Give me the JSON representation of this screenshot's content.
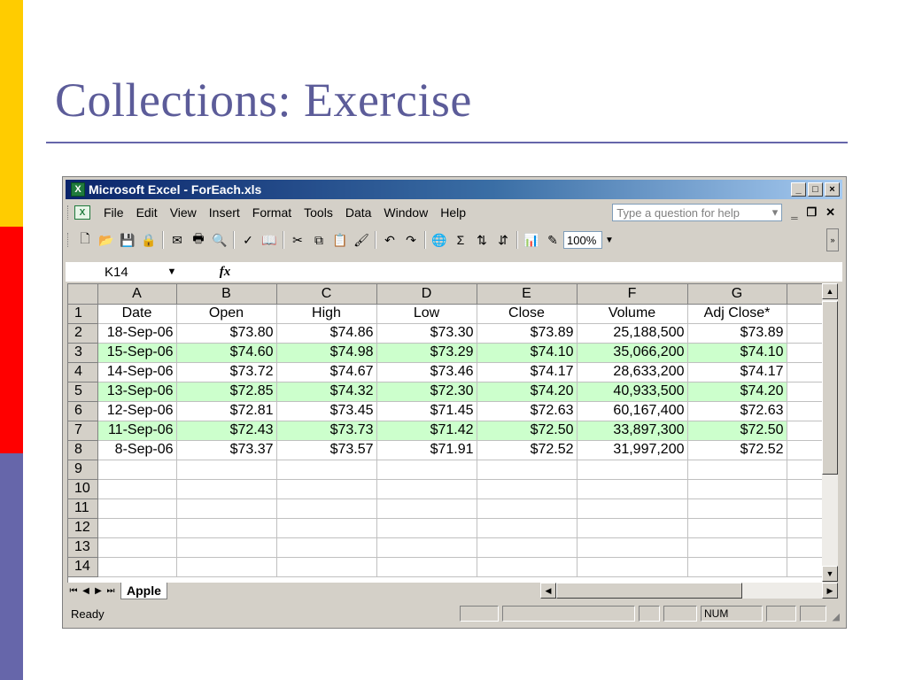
{
  "slide": {
    "title": "Collections: Exercise"
  },
  "window": {
    "title": "Microsoft Excel - ForEach.xls",
    "controls": {
      "minimize": "_",
      "restore": "□",
      "close": "×"
    }
  },
  "menubar": {
    "items": [
      {
        "label": "File"
      },
      {
        "label": "Edit"
      },
      {
        "label": "View"
      },
      {
        "label": "Insert"
      },
      {
        "label": "Format"
      },
      {
        "label": "Tools"
      },
      {
        "label": "Data"
      },
      {
        "label": "Window"
      },
      {
        "label": "Help"
      }
    ],
    "help_placeholder": "Type a question for help"
  },
  "toolbar": {
    "icons": [
      "new-icon",
      "open-icon",
      "save-icon",
      "permission-icon",
      "email-icon",
      "print-icon",
      "print-preview-icon",
      "spelling-icon",
      "research-icon",
      "cut-icon",
      "copy-icon",
      "paste-icon",
      "format-painter-icon",
      "undo-icon",
      "redo-icon",
      "hyperlink-icon",
      "autosum-icon",
      "sort-ascending-icon",
      "sort-descending-icon",
      "chart-wizard-icon",
      "drawing-icon"
    ],
    "zoom": "100%"
  },
  "formula_bar": {
    "name_box": "K14",
    "fx_label": "fx",
    "content": ""
  },
  "sheet": {
    "columns": [
      "A",
      "B",
      "C",
      "D",
      "E",
      "F",
      "G",
      ""
    ],
    "header_row": [
      "Date",
      "Open",
      "High",
      "Low",
      "Close",
      "Volume",
      "Adj Close*"
    ],
    "rows": [
      [
        "18-Sep-06",
        "$73.80",
        "$74.86",
        "$73.30",
        "$73.89",
        "25,188,500",
        "$73.89"
      ],
      [
        "15-Sep-06",
        "$74.60",
        "$74.98",
        "$73.29",
        "$74.10",
        "35,066,200",
        "$74.10"
      ],
      [
        "14-Sep-06",
        "$73.72",
        "$74.67",
        "$73.46",
        "$74.17",
        "28,633,200",
        "$74.17"
      ],
      [
        "13-Sep-06",
        "$72.85",
        "$74.32",
        "$72.30",
        "$74.20",
        "40,933,500",
        "$74.20"
      ],
      [
        "12-Sep-06",
        "$72.81",
        "$73.45",
        "$71.45",
        "$72.63",
        "60,167,400",
        "$72.63"
      ],
      [
        "11-Sep-06",
        "$72.43",
        "$73.73",
        "$71.42",
        "$72.50",
        "33,897,300",
        "$72.50"
      ],
      [
        "8-Sep-06",
        "$73.37",
        "$73.57",
        "$71.91",
        "$72.52",
        "31,997,200",
        "$72.52"
      ]
    ],
    "row_numbers": [
      "1",
      "2",
      "3",
      "4",
      "5",
      "6",
      "7",
      "8",
      "9",
      "10",
      "11",
      "12",
      "13",
      "14"
    ],
    "banded_color": "#ccffcc"
  },
  "tabs": {
    "active": "Apple"
  },
  "status": {
    "text": "Ready",
    "num": "NUM"
  }
}
